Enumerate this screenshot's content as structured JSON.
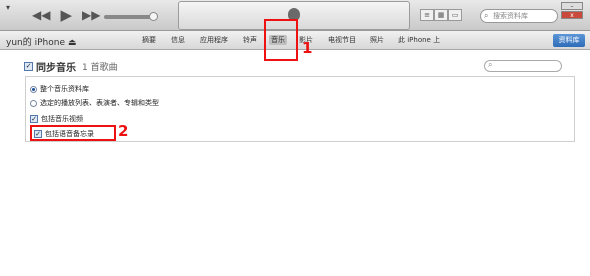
{
  "window": {
    "system_menu": "▾"
  },
  "search": {
    "placeholder": "搜索资料库"
  },
  "device": {
    "name": "yun的 iPhone",
    "eject": "⏏"
  },
  "tabs": [
    {
      "label": "摘要"
    },
    {
      "label": "信息"
    },
    {
      "label": "应用程序"
    },
    {
      "label": "铃声"
    },
    {
      "label": "音乐",
      "active": true
    },
    {
      "label": "影片"
    },
    {
      "label": "电视节目"
    },
    {
      "label": "照片"
    },
    {
      "label": "此 iPhone 上"
    }
  ],
  "library_button": "资料库",
  "sync": {
    "title": "同步音乐",
    "count": "1 首歌曲",
    "checked": true
  },
  "options": {
    "entire_library": "整个音乐资料库",
    "selected_playlists": "选定的播放列表、表演者、专辑和类型",
    "include_videos": "包括音乐视频",
    "include_voice_memos": "包括语音备忘录"
  },
  "annotations": {
    "one": "1",
    "two": "2"
  },
  "colors": {
    "highlight": "#e11111",
    "accent": "#2e6cb8"
  }
}
